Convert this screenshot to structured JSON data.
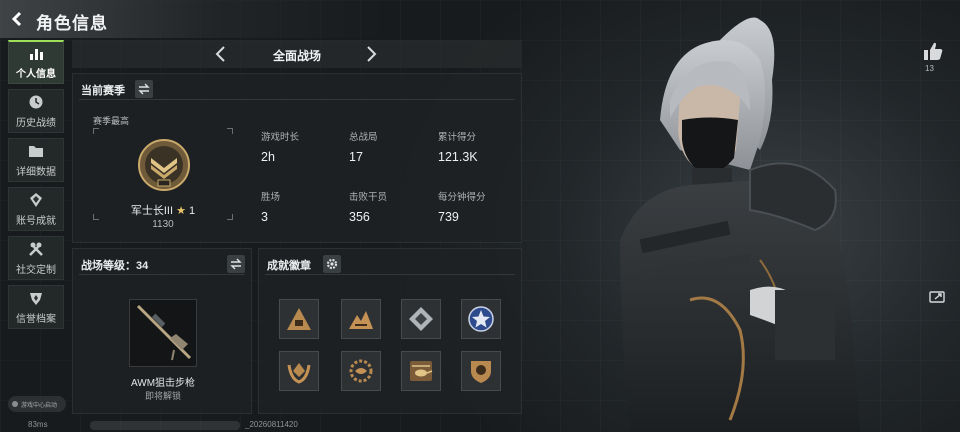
{
  "header": {
    "title": "角色信息"
  },
  "sidebar": {
    "items": [
      {
        "label": "个人信息",
        "icon": "bar-chart-icon",
        "active": true
      },
      {
        "label": "历史战绩",
        "icon": "history-icon",
        "active": false
      },
      {
        "label": "详细数据",
        "icon": "folder-icon",
        "active": false
      },
      {
        "label": "账号成就",
        "icon": "achievement-icon",
        "active": false
      },
      {
        "label": "社交定制",
        "icon": "tools-icon",
        "active": false
      },
      {
        "label": "信誉档案",
        "icon": "shield-icon",
        "active": false
      }
    ],
    "game_center": "游戏中心启动"
  },
  "mode_selector": {
    "label": "全面战场"
  },
  "season": {
    "title": "当前赛季",
    "best_label": "赛季最高",
    "rank_name": "军士长III",
    "rank_star": "★",
    "rank_stars": "1",
    "rank_points": "1130",
    "stats": [
      {
        "key": "游戏时长",
        "value": "2h"
      },
      {
        "key": "总战局",
        "value": "17"
      },
      {
        "key": "累计得分",
        "value": "121.3K"
      },
      {
        "key": "胜场",
        "value": "3"
      },
      {
        "key": "击败干员",
        "value": "356"
      },
      {
        "key": "每分钟得分",
        "value": "739"
      }
    ]
  },
  "battlefield_level": {
    "title": "战场等级：34",
    "weapon_name": "AWM狙击步枪",
    "weapon_status": "即将解锁"
  },
  "badges": {
    "title": "成就徽章",
    "items": [
      "badge-triangle-bronze",
      "badge-mountain-bronze",
      "badge-diamond-silver",
      "badge-star-blue",
      "badge-laurel-bronze",
      "badge-wreath-bronze",
      "badge-helicopter-bronze",
      "badge-shield-bronze"
    ]
  },
  "social": {
    "like_count": "13"
  },
  "footer": {
    "ping": "83ms",
    "uid_suffix": "_20260811420"
  },
  "colors": {
    "accent_green": "#9ee05a",
    "gold": "#e9c66b"
  }
}
